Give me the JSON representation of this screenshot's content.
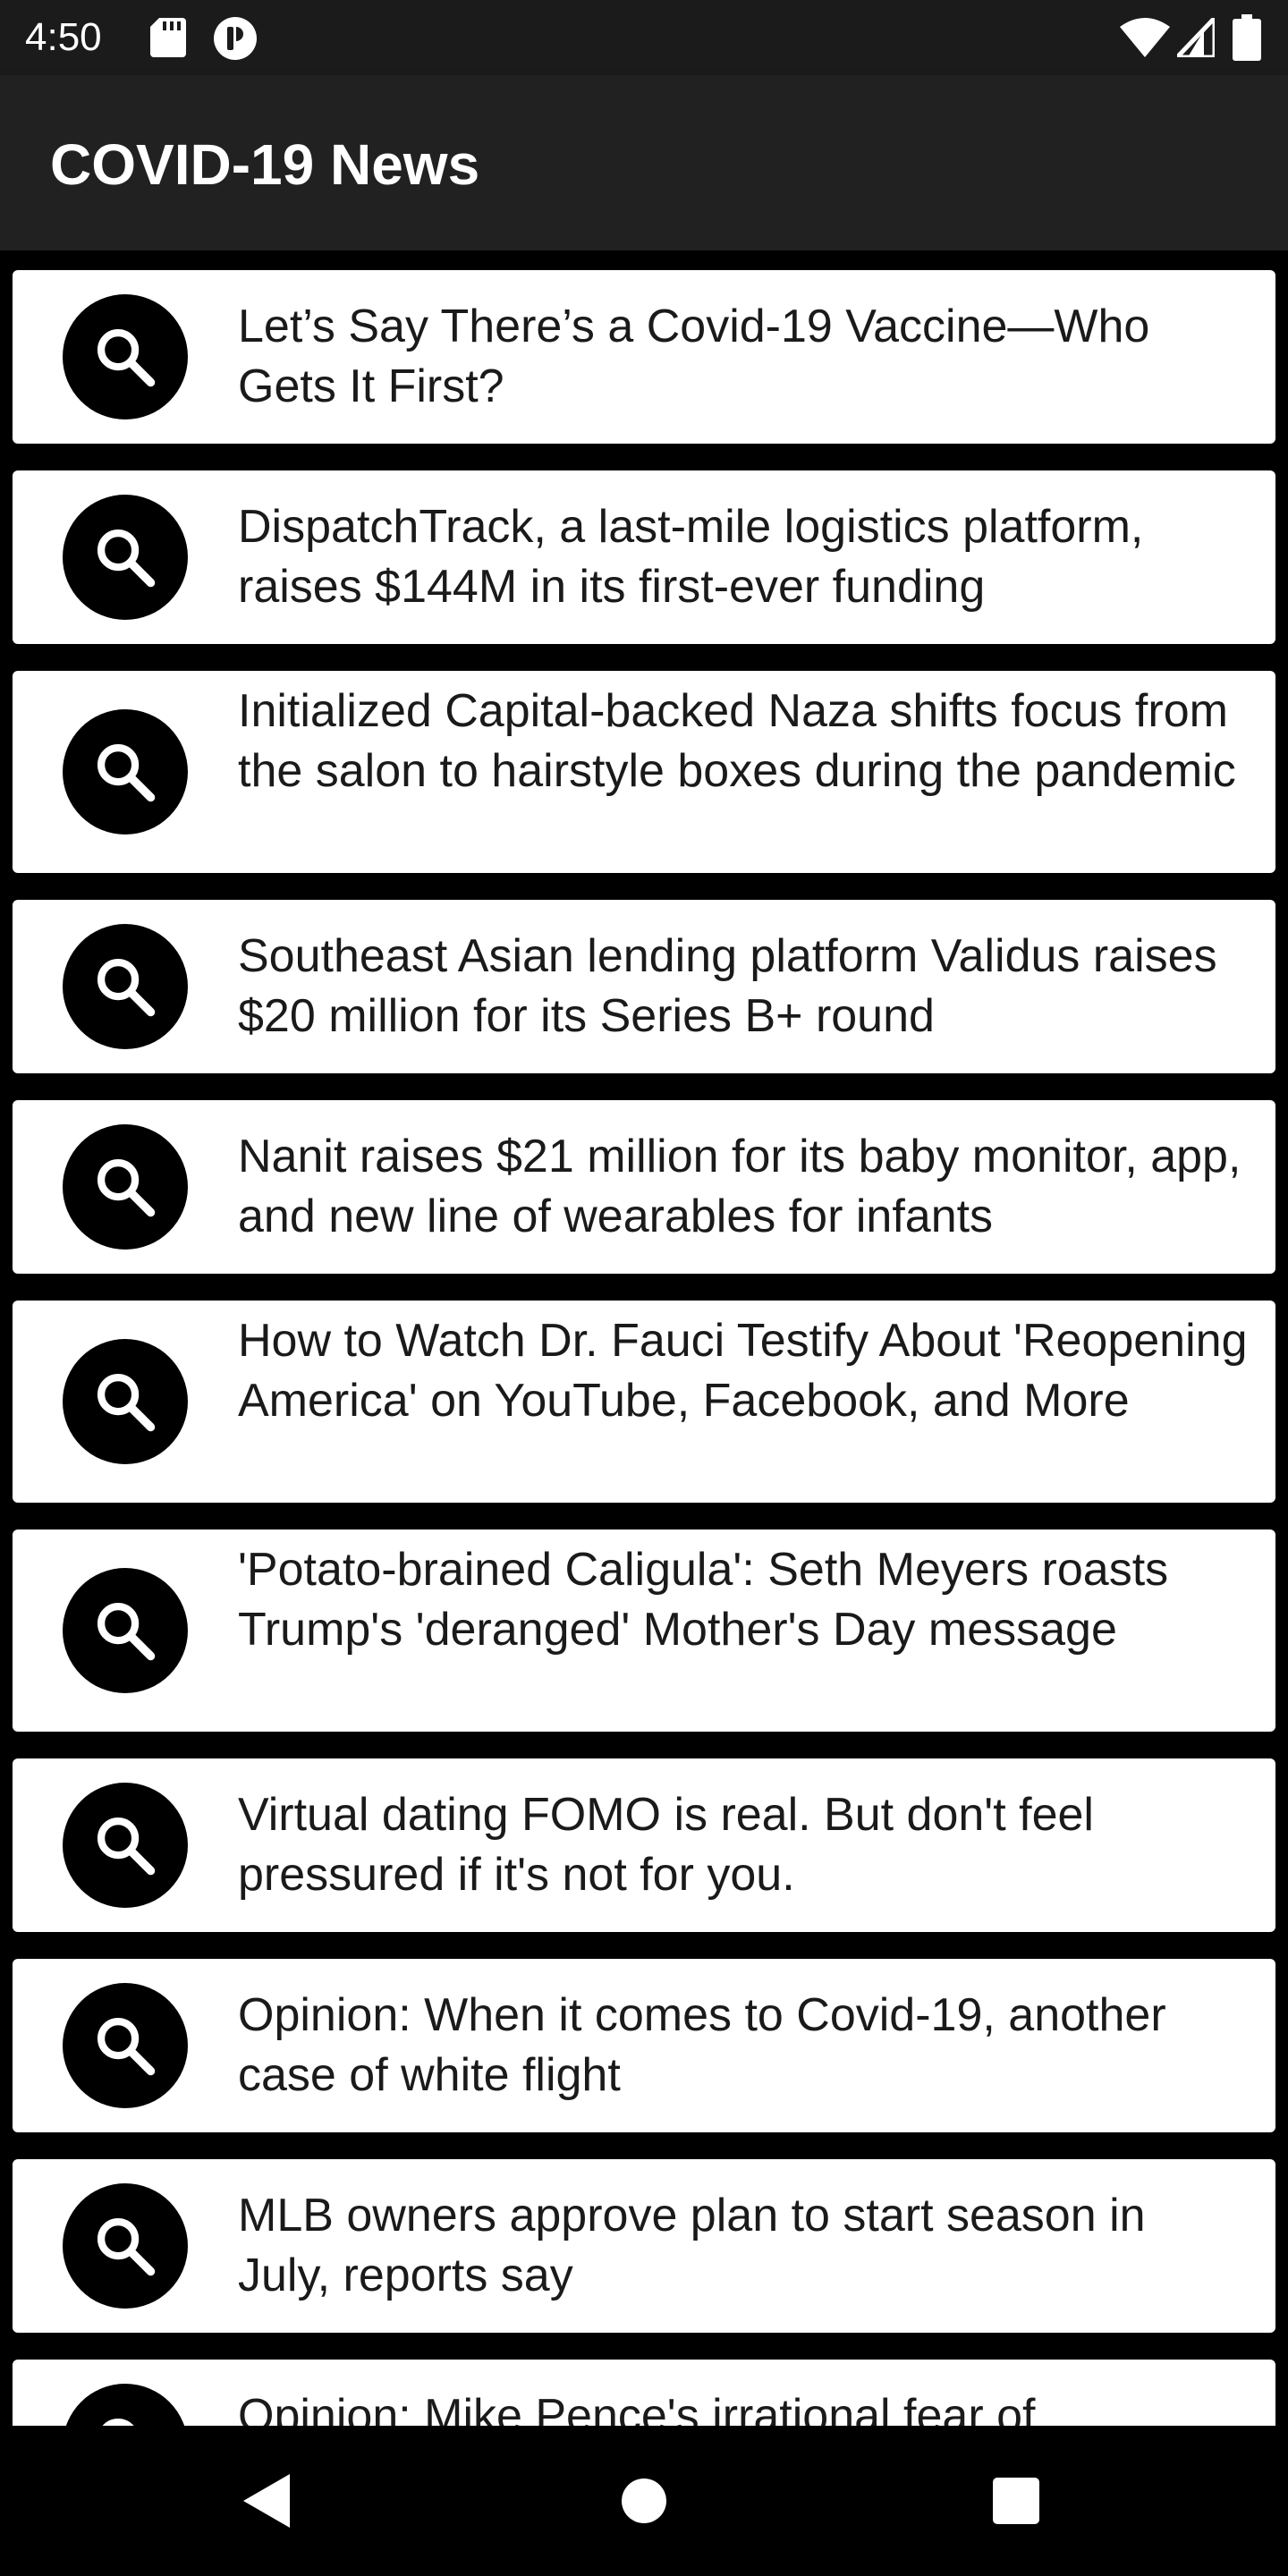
{
  "status_bar": {
    "time": "4:50",
    "icons": [
      "sd-card-icon",
      "app-notification-icon",
      "wifi-icon",
      "signal-icon",
      "battery-icon"
    ]
  },
  "app_bar": {
    "title": "COVID-19 News"
  },
  "news": {
    "items": [
      {
        "title": "Let’s Say There’s a Covid-19 Vaccine—Who Gets It First?",
        "icon": "search-icon"
      },
      {
        "title": "DispatchTrack, a last-mile logistics platform, raises $144M in its first-ever funding",
        "icon": "search-icon"
      },
      {
        "title": "Initialized Capital-backed Naza shifts focus from the salon to hairstyle boxes during the pandemic",
        "icon": "search-icon"
      },
      {
        "title": "Southeast Asian lending platform Validus raises $20 million for its Series B+ round",
        "icon": "search-icon"
      },
      {
        "title": "Nanit raises $21 million for its baby monitor, app, and new line of wearables for infants",
        "icon": "search-icon"
      },
      {
        "title": "How to Watch Dr. Fauci Testify About 'Reopening America' on YouTube, Facebook, and More",
        "icon": "search-icon"
      },
      {
        "title": "'Potato-brained Caligula': Seth Meyers roasts Trump's 'deranged' Mother's Day message",
        "icon": "search-icon"
      },
      {
        "title": "Virtual dating FOMO is real. But don't feel pressured if it's not for you.",
        "icon": "search-icon"
      },
      {
        "title": "Opinion: When it comes to Covid-19, another case of white flight",
        "icon": "search-icon"
      },
      {
        "title": "MLB owners approve plan to start season in July, reports say",
        "icon": "search-icon"
      },
      {
        "title": "Opinion: Mike Pence's irrational fear of",
        "icon": "search-icon"
      }
    ]
  },
  "nav_bar": {
    "buttons": [
      "back-icon",
      "home-icon",
      "recents-icon"
    ]
  },
  "colors": {
    "status_bar": "#1b1b1b",
    "app_bar": "#212121",
    "background": "#000000",
    "card": "#ffffff",
    "avatar": "#000000",
    "text": "#1a1a1a"
  }
}
